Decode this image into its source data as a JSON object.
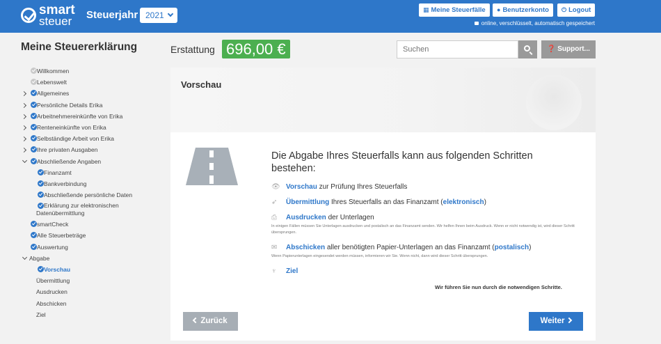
{
  "header": {
    "logo_line1": "smart",
    "logo_line2": "steuer",
    "year_label": "Steuerjahr",
    "year_value": "2021",
    "btn_cases": "Meine Steuerfälle",
    "btn_account": "Benutzerkonto",
    "btn_logout": "Logout",
    "secure_text": "online, verschlüsselt, automatisch gespeichert"
  },
  "subheader": {
    "heading": "Meine Steuererklärung",
    "refund_label": "Erstattung",
    "refund_amount": "696,00 €",
    "search_placeholder": "Suchen",
    "support_label": "Support..."
  },
  "sidebar": {
    "items": [
      {
        "label": "Willkommen"
      },
      {
        "label": "Lebenswelt"
      },
      {
        "label": "Allgemeines"
      },
      {
        "label": "Persönliche Details Erika"
      },
      {
        "label": "Arbeitnehmereinkünfte von Erika"
      },
      {
        "label": "Renteneinkünfte von Erika"
      },
      {
        "label": "Selbständige Arbeit von Erika"
      },
      {
        "label": "Ihre privaten Ausgaben"
      },
      {
        "label": "Abschließende Angaben"
      },
      {
        "label": "Finanzamt"
      },
      {
        "label": "Bankverbindung"
      },
      {
        "label": "Abschließende persönliche Daten"
      },
      {
        "label": "Erklärung zur elektronischen Datenübermittlung"
      },
      {
        "label": "smartCheck"
      },
      {
        "label": "Alle Steuerbeträge"
      },
      {
        "label": "Auswertung"
      },
      {
        "label": "Abgabe"
      },
      {
        "label": "Vorschau"
      },
      {
        "label": "Übermittlung"
      },
      {
        "label": "Ausdrucken"
      },
      {
        "label": "Abschicken"
      },
      {
        "label": "Ziel"
      }
    ]
  },
  "main": {
    "title": "Vorschau",
    "steps_title": "Die Abgabe Ihres Steuerfalls kann aus folgenden Schritten bestehen:",
    "steps": [
      {
        "bold": "Vorschau",
        "rest": " zur Prüfung Ihres Steuerfalls"
      },
      {
        "bold": "Übermittlung",
        "rest": " Ihres Steuerfalls an das Finanzamt (",
        "bold2": "elektronisch",
        "rest2": ")"
      },
      {
        "bold": "Ausdrucken",
        "rest": " der Unterlagen",
        "note": "In einigen Fällen müssen Sie Unterlagen ausdrucken und postalisch an das Finanzamt senden. Wir helfen Ihnen beim Ausdruck. Wenn er nicht notwendig ist, wird dieser Schritt übersprungen."
      },
      {
        "bold": "Abschicken",
        "rest": " aller benötigten Papier-Unterlagen an das Finanzamt (",
        "bold2": "postalisch",
        "rest2": ")",
        "note": "Wenn Papierunterlagen eingesendet werden müssen, informieren wir Sie. Wenn nicht, dann wird dieser Schritt übersprungen."
      },
      {
        "bold": "Ziel"
      }
    ],
    "final_text": "Wir führen Sie nun durch die notwendigen Schritte.",
    "back_label": "Zurück",
    "next_label": "Weiter"
  }
}
